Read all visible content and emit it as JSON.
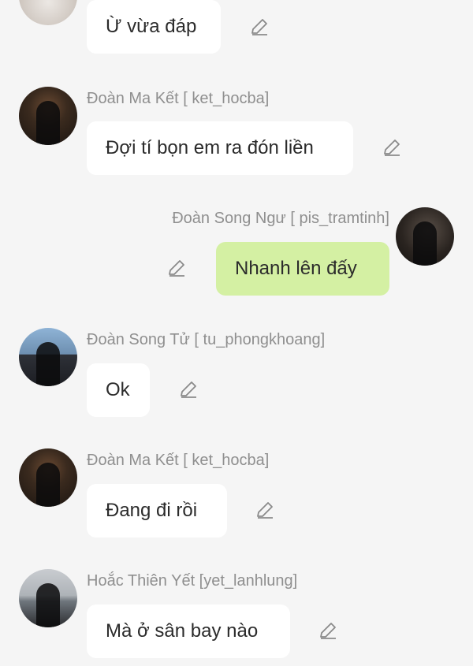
{
  "messages": [
    {
      "sender": "",
      "text": "Ừ vừa đáp",
      "avatar_icon": "avatar-photo",
      "mine": false
    },
    {
      "sender": "Đoàn Ma Kết [ ket_hocba]",
      "text": "Đợi tí bọn em ra đón liền",
      "avatar_icon": "avatar-photo",
      "mine": false
    },
    {
      "sender": "Đoàn Song Ngư [ pis_tramtinh]",
      "text": "Nhanh lên đấy",
      "avatar_icon": "avatar-photo",
      "mine": true
    },
    {
      "sender": "Đoàn Song Tử [ tu_phongkhoang]",
      "text": "Ok",
      "avatar_icon": "avatar-photo",
      "mine": false
    },
    {
      "sender": "Đoàn Ma Kết [ ket_hocba]",
      "text": "Đang đi rồi",
      "avatar_icon": "avatar-photo",
      "mine": false
    },
    {
      "sender": "Hoắc Thiên Yết [yet_lanhlung]",
      "text": "Mà ở sân bay nào",
      "avatar_icon": "avatar-photo",
      "mine": false
    }
  ],
  "colors": {
    "background": "#f5f5f5",
    "bubble_other": "#ffffff",
    "bubble_mine": "#d4f0a3",
    "sender_text": "#8f8f8f",
    "message_text": "#2b2b2b"
  },
  "icons": {
    "edit": "pencil-edit-icon"
  }
}
